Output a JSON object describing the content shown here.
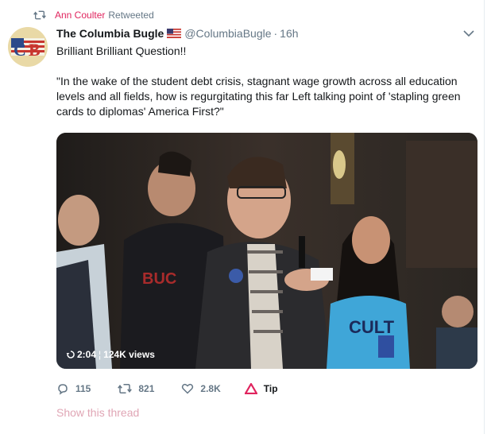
{
  "retweet": {
    "user": "Ann Coulter",
    "label": "Retweeted"
  },
  "tweet": {
    "display_name": "The Columbia Bugle",
    "handle": "@ColumbiaBugle",
    "separator": "·",
    "time": "16h",
    "line1": "Brilliant Brilliant Question!!",
    "line2": "\"In the wake of the student debt crisis, stagnant wage growth across all education levels and all fields, how is regurgitating this far Left talking point of 'stapling green cards to diplomas' America First?\""
  },
  "video": {
    "duration": "2:04",
    "views": "124K views",
    "shirt_text": "CULT"
  },
  "actions": {
    "replies": "115",
    "retweets": "821",
    "likes": "2.8K",
    "tip": "Tip"
  },
  "show_thread": "Show this thread",
  "colors": {
    "link_pink": "#e0245e",
    "muted": "#657786",
    "text": "#14171a",
    "tip_red": "#e0245e"
  }
}
